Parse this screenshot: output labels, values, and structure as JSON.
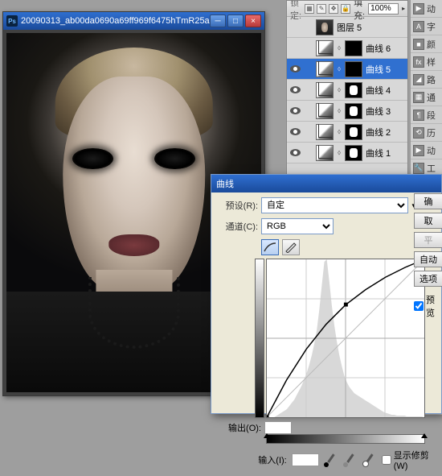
{
  "doc_window": {
    "title": "20090313_ab00da0690a69ff969f6475hTmR25a..."
  },
  "layers_panel": {
    "lock_label": "锁定:",
    "fill_label": "填充:",
    "fill_value": "100%",
    "layers": [
      {
        "eye": false,
        "type": "image",
        "label": "图层 5"
      },
      {
        "eye": false,
        "type": "curves",
        "label": "曲线 6"
      },
      {
        "eye": true,
        "type": "curves",
        "label": "曲线 5",
        "selected": true
      },
      {
        "eye": true,
        "type": "curves",
        "label": "曲线 4"
      },
      {
        "eye": true,
        "type": "curves",
        "label": "曲线 3"
      },
      {
        "eye": true,
        "type": "curves",
        "label": "曲线 2"
      },
      {
        "eye": true,
        "type": "curves",
        "label": "曲线 1"
      }
    ]
  },
  "tabstrip": {
    "items": [
      "动",
      "字",
      "颜",
      "样",
      "路",
      "通",
      "段",
      "历",
      "动",
      "工"
    ]
  },
  "curves_dialog": {
    "title": "曲线",
    "preset_label": "预设(R):",
    "preset_value": "自定",
    "channel_label": "通道(C):",
    "channel_value": "RGB",
    "output_label": "输出(O):",
    "output_value": "",
    "input_label": "输入(I):",
    "input_value": "",
    "show_clipping_label": "显示修剪(W)",
    "show_clipping_checked": false,
    "buttons": {
      "ok": "确",
      "cancel": "取",
      "smooth": "平",
      "auto": "自动",
      "options": "选项",
      "preview": "预览"
    },
    "preview_checked": true
  },
  "chart_data": {
    "type": "line",
    "title": "曲线",
    "xlabel": "输入(I)",
    "ylabel": "输出(O)",
    "xlim": [
      0,
      255
    ],
    "ylim": [
      0,
      255
    ],
    "grid": true,
    "series": [
      {
        "name": "diagonal",
        "x": [
          0,
          255
        ],
        "y": [
          0,
          255
        ]
      },
      {
        "name": "curve",
        "x": [
          0,
          32,
          64,
          96,
          128,
          160,
          192,
          224,
          255
        ],
        "y": [
          0,
          60,
          110,
          150,
          182,
          206,
          226,
          242,
          255
        ]
      }
    ],
    "control_points": [
      {
        "x": 0,
        "y": 0
      },
      {
        "x": 128,
        "y": 182
      },
      {
        "x": 255,
        "y": 255
      }
    ],
    "histogram": [
      0,
      0,
      0,
      0,
      2,
      4,
      6,
      8,
      10,
      14,
      18,
      22,
      28,
      34,
      40,
      48,
      56,
      66,
      78,
      92,
      110,
      135,
      165,
      195,
      198,
      170,
      140,
      115,
      95,
      78,
      64,
      52,
      44,
      38,
      34,
      30,
      28,
      26,
      24,
      22,
      20,
      18,
      16,
      14,
      12,
      10,
      8,
      6,
      5,
      4,
      3,
      3,
      2,
      2,
      2,
      2,
      1,
      1,
      1,
      1,
      1,
      1,
      1,
      0
    ]
  }
}
